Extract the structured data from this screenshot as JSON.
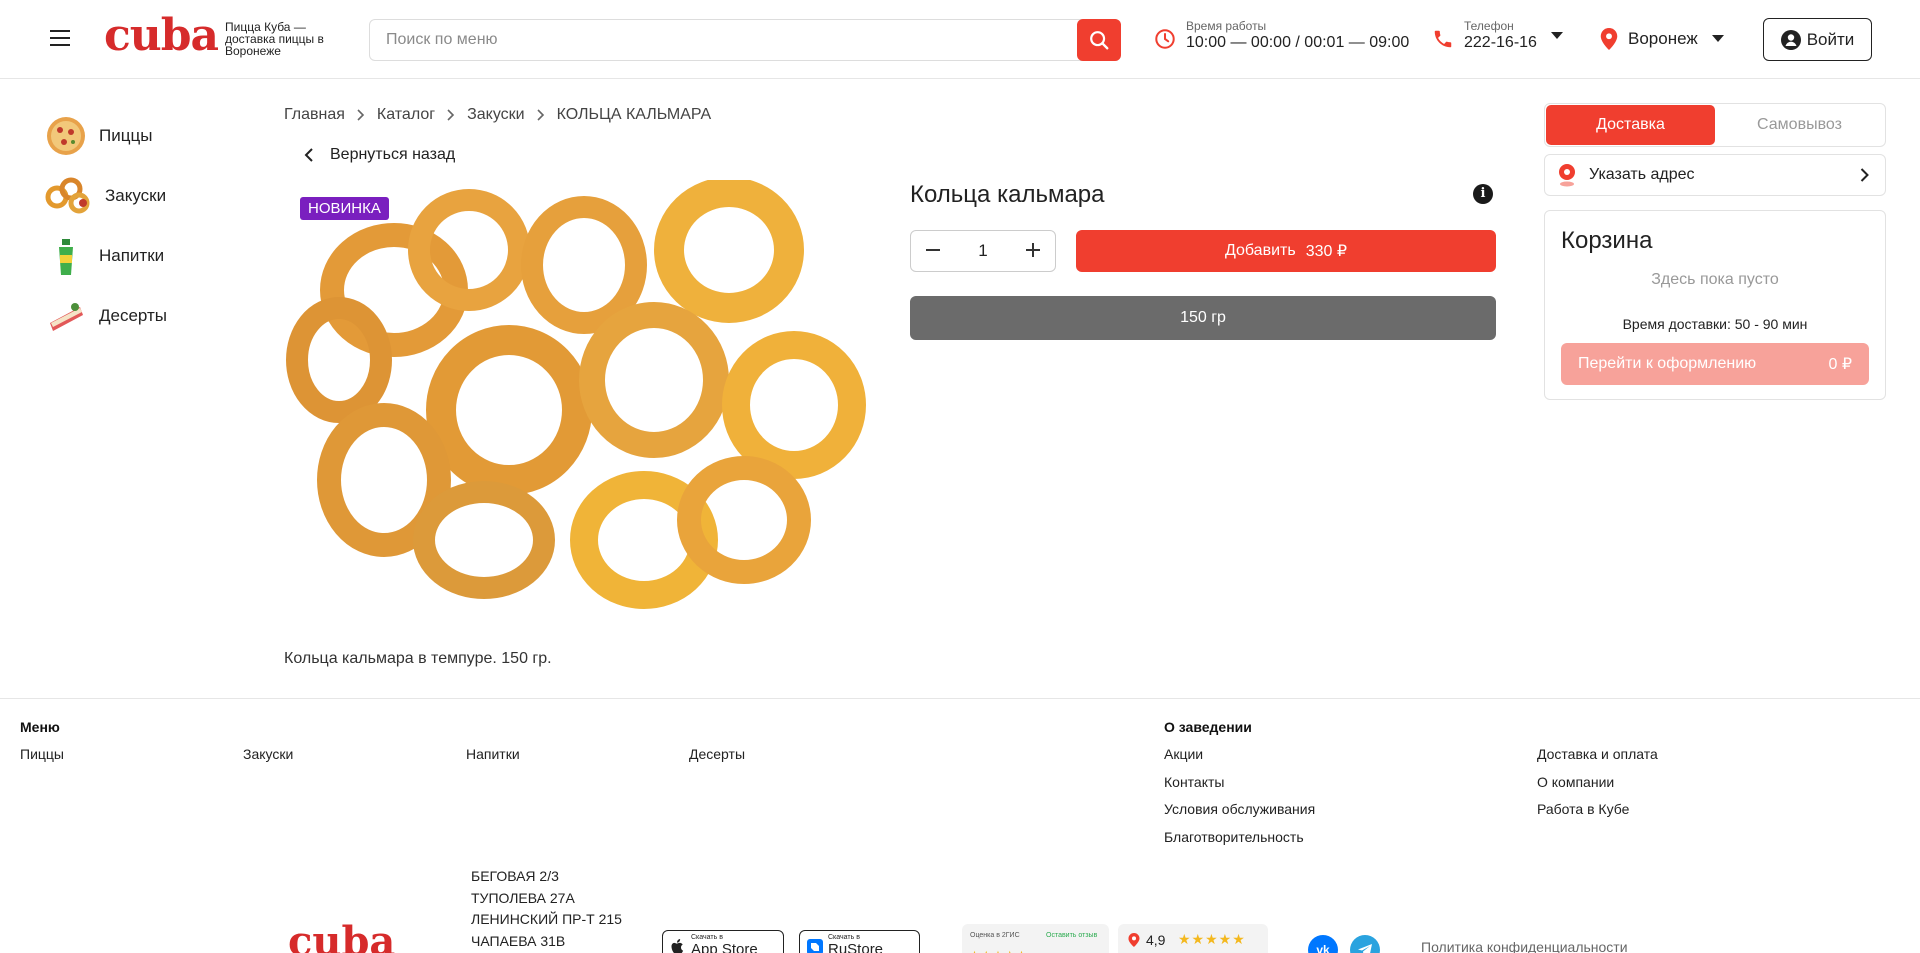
{
  "brand": {
    "logo_text": "cuba",
    "tagline": "Пицца Куба — доставка пиццы в Воронеже",
    "accent_color": "#f03e2f",
    "logo_color": "#d62b2b"
  },
  "header": {
    "search_placeholder": "Поиск по меню",
    "hours_label": "Время работы",
    "hours_value": "10:00 — 00:00 / 00:01 — 09:00",
    "phone_label": "Телефон",
    "phone_value": "222-16-16",
    "city": "Воронеж",
    "login_label": "Войти"
  },
  "sidebar": {
    "items": [
      {
        "label": "Пиццы",
        "icon": "pizza-thumb"
      },
      {
        "label": "Закуски",
        "icon": "snacks-thumb"
      },
      {
        "label": "Напитки",
        "icon": "drinks-thumb"
      },
      {
        "label": "Десерты",
        "icon": "desserts-thumb"
      }
    ]
  },
  "breadcrumb": [
    "Главная",
    "Каталог",
    "Закуски",
    "КОЛЬЦА КАЛЬМАРА"
  ],
  "back_label": "Вернуться назад",
  "product": {
    "badge": "НОВИНКА",
    "title": "Кольца кальмара",
    "info_icon": "i",
    "quantity": "1",
    "add_label": "Добавить",
    "price": "330 ₽",
    "weight": "150 гр",
    "description": "Кольца кальмара в темпуре. 150 гр."
  },
  "order_panel": {
    "tabs": [
      {
        "label": "Доставка",
        "active": true
      },
      {
        "label": "Самовывоз",
        "active": false
      }
    ],
    "address_label": "Указать адрес",
    "cart": {
      "title": "Корзина",
      "empty_text": "Здесь пока пусто",
      "delivery_time": "Время доставки: 50 - 90 мин",
      "checkout_label": "Перейти к оформлению",
      "total": "0 ₽"
    }
  },
  "footer": {
    "menu_heading": "Меню",
    "menu_links": [
      "Пиццы",
      "Закуски",
      "Напитки",
      "Десерты"
    ],
    "about_heading": "О заведении",
    "about_links": [
      "Акции",
      "Контакты",
      "Условия обслуживания",
      "Благотворительность"
    ],
    "extra_links": [
      "Доставка и оплата",
      "О компании",
      "Работа в Кубе"
    ],
    "addresses": [
      "БЕГОВАЯ 2/3",
      "ТУПОЛЕВА 27А",
      "ЛЕНИНСКИЙ ПР-Т 215",
      "ЧАПАЕВА 31В"
    ],
    "logo_text": "cuba",
    "app_store": {
      "small": "Скачать в",
      "big": "App Store"
    },
    "ru_store": {
      "small": "Скачать в",
      "big": "RuStore"
    },
    "gis_label": "Оценка в 2ГИС",
    "gis_action": "Оставить отзыв",
    "rating_value": "4,9",
    "social": [
      "vk",
      "telegram"
    ],
    "policy_label": "Политика конфиденциальности"
  }
}
